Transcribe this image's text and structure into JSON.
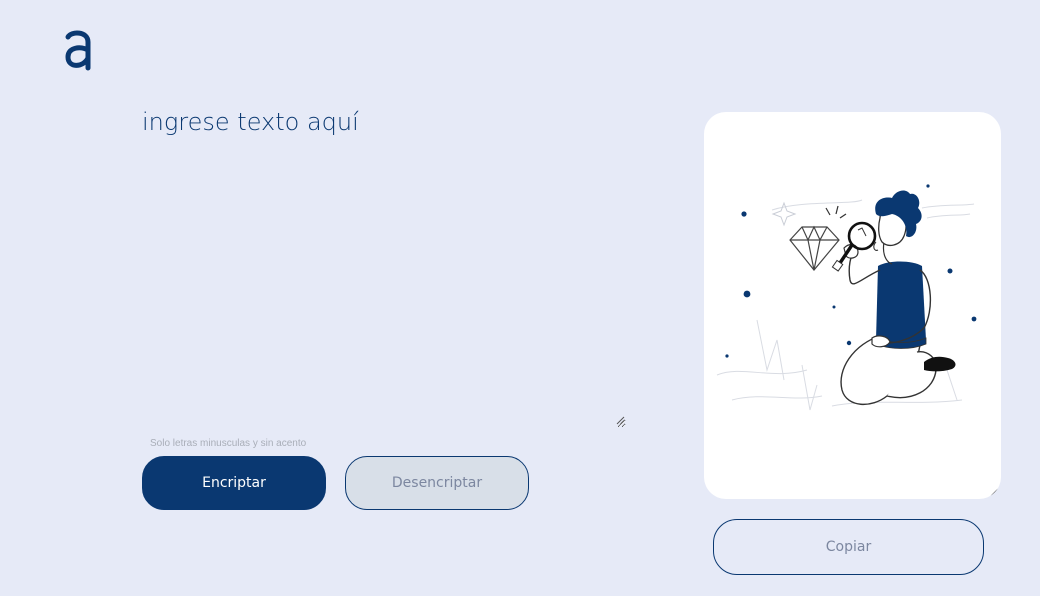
{
  "brand": {
    "logo_icon": "alura-logo-icon",
    "logo_glyph": "a"
  },
  "editor": {
    "placeholder": "ingrese texto aquí",
    "value": ""
  },
  "hint": {
    "text": "Solo letras minusculas y sin acento"
  },
  "actions": {
    "encrypt_label": "Encriptar",
    "decrypt_label": "Desencriptar"
  },
  "output": {
    "illustration": "person-with-magnifier-and-diamond-illustration",
    "copy_label": "Copiar"
  },
  "colors": {
    "background": "#E6EAF7",
    "primary": "#0A3871",
    "secondary_button": "#D8DFE8",
    "panel": "#FFFFFF",
    "muted_text": "#7C87A0"
  }
}
